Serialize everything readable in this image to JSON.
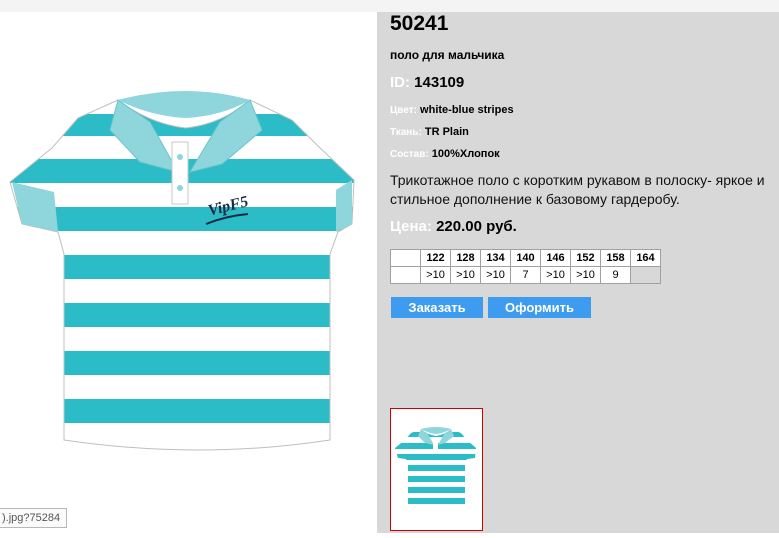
{
  "product": {
    "sku": "50241",
    "subtitle": "поло для мальчика",
    "id_label": "ID:",
    "id_value": "143109",
    "color_label": "Цвет:",
    "color_value": "white-blue stripes",
    "fabric_label": "Ткань:",
    "fabric_value": "TR Plain",
    "composition_label": "Состав:",
    "composition_value": "100%Хлопок",
    "description": "Трикотажное поло с коротким рукавом в полоску- яркое и стильное дополнение к базовому гардеробу.",
    "price_label": "Цена:",
    "price_value": "220.00 руб."
  },
  "sizes": {
    "headers": [
      "122",
      "128",
      "134",
      "140",
      "146",
      "152",
      "158",
      "164"
    ],
    "stock": [
      ">10",
      ">10",
      ">10",
      "7",
      ">10",
      ">10",
      "9",
      ""
    ]
  },
  "buttons": {
    "order": "Заказать",
    "checkout": "Оформить"
  },
  "image": {
    "logo_text": "VipF5",
    "url_tooltip": ").jpg?75284"
  },
  "colors": {
    "stripe": "#2bbcc8",
    "collar": "#8fd6dc",
    "button": "#3d9cf0",
    "panel": "#d8d8d8",
    "thumb_border": "#cc0000"
  }
}
